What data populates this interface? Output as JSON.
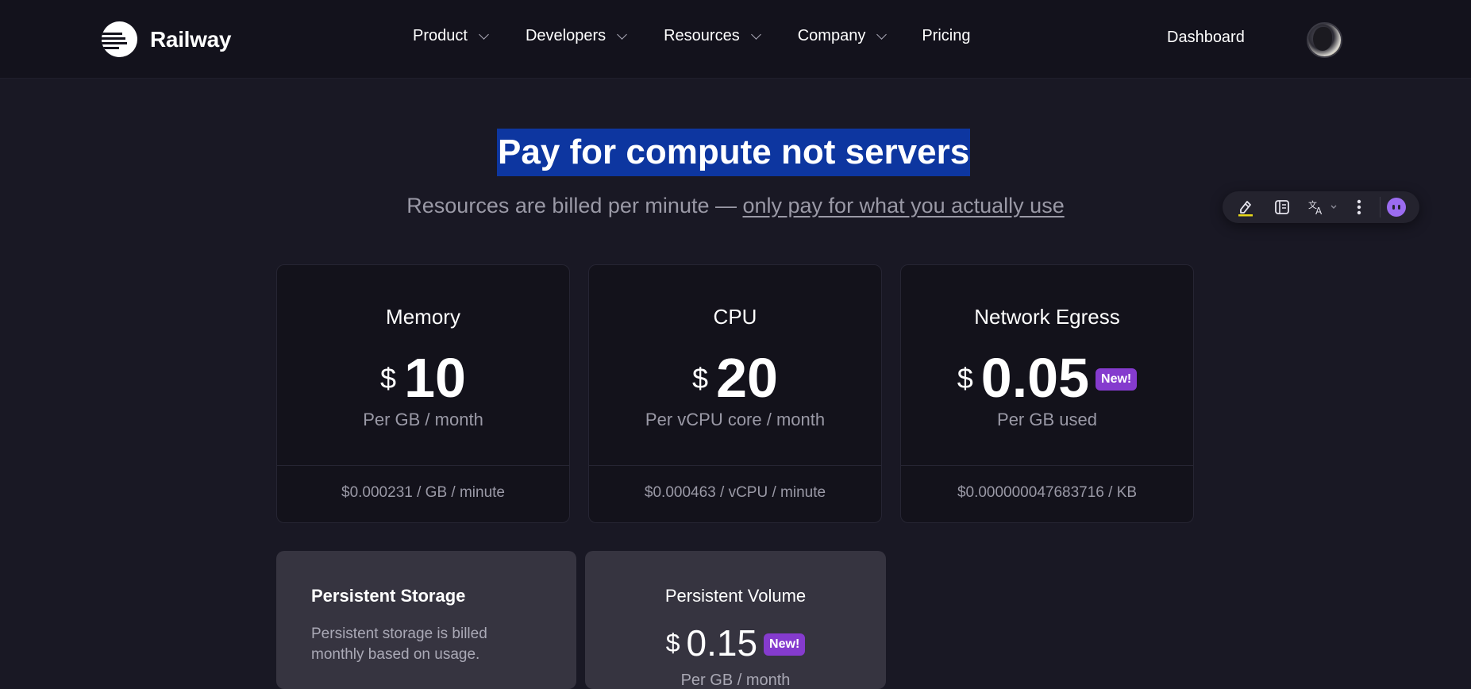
{
  "header": {
    "brand": "Railway",
    "nav": [
      {
        "label": "Product",
        "has_dropdown": true
      },
      {
        "label": "Developers",
        "has_dropdown": true
      },
      {
        "label": "Resources",
        "has_dropdown": true
      },
      {
        "label": "Company",
        "has_dropdown": true
      },
      {
        "label": "Pricing",
        "has_dropdown": false
      }
    ],
    "dashboard": "Dashboard"
  },
  "hero": {
    "title": "Pay for compute not servers",
    "subtitle_prefix": "Resources are billed per minute — ",
    "subtitle_link": "only pay for what you actually use"
  },
  "toolbar": {
    "icons": [
      "highlighter-icon",
      "reader-icon",
      "translate-icon",
      "more-vertical-icon",
      "ai-assistant-icon"
    ]
  },
  "pricing": [
    {
      "title": "Memory",
      "currency": "$",
      "amount": "10",
      "unit": "Per GB / month",
      "rate": "$0.000231 / GB / minute",
      "badge": ""
    },
    {
      "title": "CPU",
      "currency": "$",
      "amount": "20",
      "unit": "Per vCPU core / month",
      "rate": "$0.000463 / vCPU / minute",
      "badge": ""
    },
    {
      "title": "Network Egress",
      "currency": "$",
      "amount": "0.05",
      "unit": "Per GB used",
      "rate": "$0.000000047683716 / KB",
      "badge": "New!"
    }
  ],
  "storage": {
    "title": "Persistent Storage",
    "description": "Persistent storage is billed monthly based on usage."
  },
  "volume": {
    "title": "Persistent Volume",
    "currency": "$",
    "amount": "0.15",
    "badge": "New!",
    "unit": "Per GB / month"
  },
  "colors": {
    "background": "#191824",
    "header": "#13121c",
    "card": "#13121b",
    "card_alt": "#363440",
    "badge": "#853bce",
    "selection": "#0d36a0",
    "muted_text": "#9a99a6"
  }
}
